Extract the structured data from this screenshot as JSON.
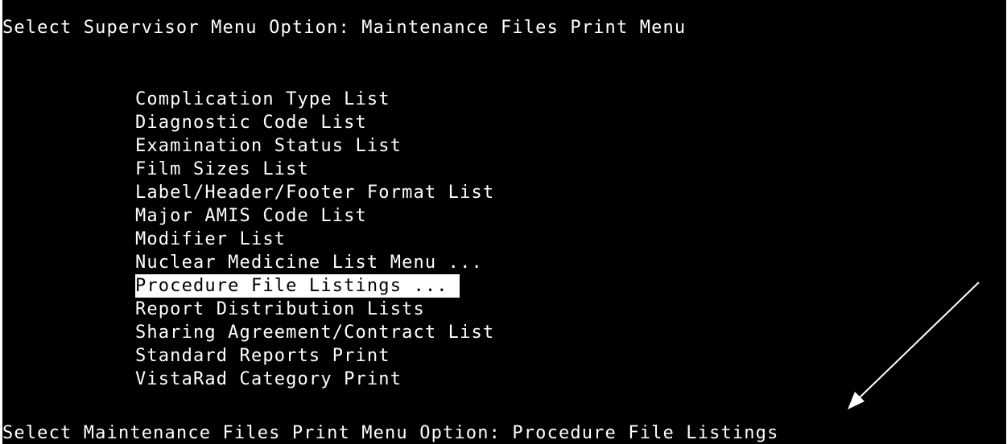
{
  "terminal": {
    "header_prompt": "Select Supervisor Menu Option: Maintenance Files Print Menu",
    "menu_items": [
      {
        "label": "Complication Type List"
      },
      {
        "label": "Diagnostic Code List"
      },
      {
        "label": "Examination Status List"
      },
      {
        "label": "Film Sizes List"
      },
      {
        "label": "Label/Header/Footer Format List"
      },
      {
        "label": "Major AMIS Code List"
      },
      {
        "label": "Modifier List"
      },
      {
        "label": "Nuclear Medicine List Menu ..."
      },
      {
        "label": "Procedure File Listings ... ",
        "highlighted": true
      },
      {
        "label": "Report Distribution Lists"
      },
      {
        "label": "Sharing Agreement/Contract List"
      },
      {
        "label": "Standard Reports Print"
      },
      {
        "label": "VistaRad Category Print"
      }
    ],
    "bottom_prompt": "Select Maintenance Files Print Menu Option: Procedure File Listings"
  },
  "colors": {
    "background": "#000000",
    "text": "#ffffff",
    "highlight_bg": "#ffffff",
    "highlight_text": "#000000"
  },
  "annotation": {
    "icon": "arrow-icon"
  }
}
